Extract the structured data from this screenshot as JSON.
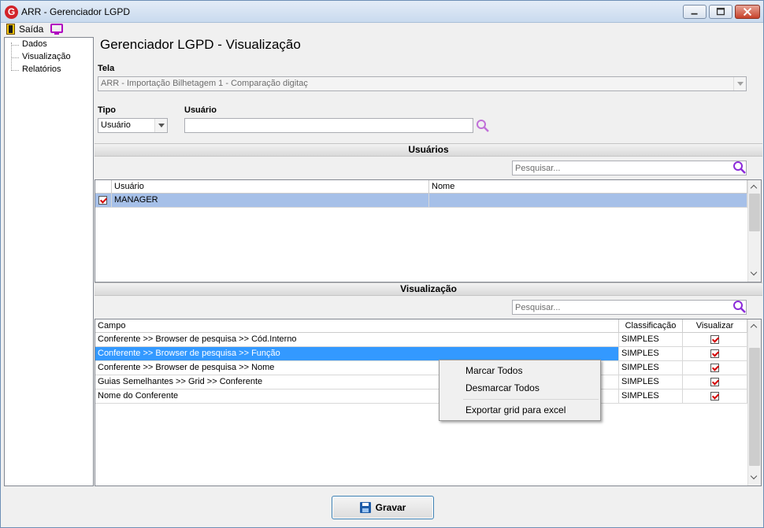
{
  "window": {
    "title": "ARR - Gerenciador LGPD",
    "logo_letter": "G"
  },
  "menubar": {
    "exit_label": "Saída"
  },
  "tree": {
    "items": [
      "Dados",
      "Visualização",
      "Relatórios"
    ]
  },
  "page": {
    "title": "Gerenciador LGPD - Visualização"
  },
  "form": {
    "tela_label": "Tela",
    "tela_value": "ARR - Importação Bilhetagem 1 - Comparação digitaç",
    "tipo_label": "Tipo",
    "tipo_value": "Usuário",
    "usuario_label": "Usuário",
    "usuario_value": ""
  },
  "users_section": {
    "header": "Usuários",
    "search_placeholder": "Pesquisar...",
    "columns": [
      "Usuário",
      "Nome"
    ],
    "rows": [
      {
        "checked": true,
        "usuario": "MANAGER",
        "nome": ""
      }
    ]
  },
  "view_section": {
    "header": "Visualização",
    "search_placeholder": "Pesquisar...",
    "columns": [
      "Campo",
      "Classificação",
      "Visualizar"
    ],
    "rows": [
      {
        "campo": "Conferente >> Browser de pesquisa >> Cód.Interno",
        "classificacao": "SIMPLES",
        "visualizar": true
      },
      {
        "campo": "Conferente >> Browser de pesquisa >> Função",
        "classificacao": "SIMPLES",
        "visualizar": true
      },
      {
        "campo": "Conferente >> Browser de pesquisa >> Nome",
        "classificacao": "SIMPLES",
        "visualizar": true
      },
      {
        "campo": "Guias Semelhantes >> Grid >> Conferente",
        "classificacao": "SIMPLES",
        "visualizar": true
      },
      {
        "campo": "Nome do Conferente",
        "classificacao": "SIMPLES",
        "visualizar": true
      }
    ]
  },
  "context_menu": {
    "items": [
      "Marcar Todos",
      "Desmarcar Todos",
      "Exportar grid para excel"
    ]
  },
  "footer": {
    "save_label": "Gravar"
  },
  "colors": {
    "selection_blue": "#3399ff",
    "selection_light": "#a6c0e8",
    "search_icon": "#8b2bd9",
    "check_red": "#d40000"
  }
}
